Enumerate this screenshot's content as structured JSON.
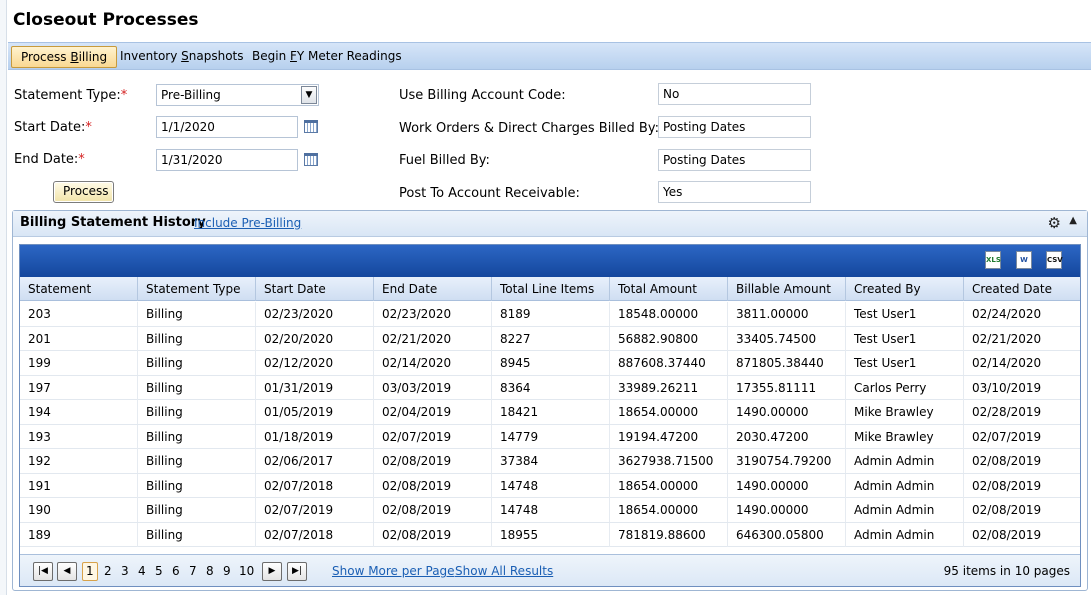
{
  "page": {
    "title": "Closeout Processes"
  },
  "tabs": [
    {
      "label_pre": "Process ",
      "mnemonic": "B",
      "label_post": "illing"
    },
    {
      "label_pre": "Inventory ",
      "mnemonic": "S",
      "label_post": "napshots"
    },
    {
      "label_pre": "Begin ",
      "mnemonic": "F",
      "label_post": "Y Meter Readings"
    }
  ],
  "form": {
    "statement_type_label": "Statement Type:",
    "statement_type_value": "Pre-Billing",
    "start_date_label": "Start Date:",
    "start_date_value": "1/1/2020",
    "end_date_label": "End Date:",
    "end_date_value": "1/31/2020",
    "required_marker": "*",
    "process_label": "Process",
    "use_billing_label": "Use Billing Account Code:",
    "use_billing_value": "No",
    "work_orders_label": "Work Orders & Direct Charges Billed By:",
    "work_orders_value": "Posting Dates",
    "fuel_label": "Fuel Billed By:",
    "fuel_value": "Posting Dates",
    "post_ar_label": "Post To Account Receivable:",
    "post_ar_value": "Yes"
  },
  "history": {
    "title": "Billing Statement History",
    "include_link": "Include Pre-Billing",
    "export_icons": [
      "excel-export-icon",
      "word-export-icon",
      "csv-export-icon"
    ],
    "columns": [
      "Statement",
      "Statement Type",
      "Start Date",
      "End Date",
      "Total Line Items",
      "Total Amount",
      "Billable Amount",
      "Created By",
      "Created Date"
    ],
    "rows": [
      [
        "203",
        "Billing",
        "02/23/2020",
        "02/23/2020",
        "8189",
        "18548.00000",
        "3811.00000",
        "Test User1",
        "02/24/2020"
      ],
      [
        "201",
        "Billing",
        "02/20/2020",
        "02/21/2020",
        "8227",
        "56882.90800",
        "33405.74500",
        "Test User1",
        "02/21/2020"
      ],
      [
        "199",
        "Billing",
        "02/12/2020",
        "02/14/2020",
        "8945",
        "887608.37440",
        "871805.38440",
        "Test User1",
        "02/14/2020"
      ],
      [
        "197",
        "Billing",
        "01/31/2019",
        "03/03/2019",
        "8364",
        "33989.26211",
        "17355.81111",
        "Carlos Perry",
        "03/10/2019"
      ],
      [
        "194",
        "Billing",
        "01/05/2019",
        "02/04/2019",
        "18421",
        "18654.00000",
        "1490.00000",
        "Mike Brawley",
        "02/28/2019"
      ],
      [
        "193",
        "Billing",
        "01/18/2019",
        "02/07/2019",
        "14779",
        "19194.47200",
        "2030.47200",
        "Mike Brawley",
        "02/07/2019"
      ],
      [
        "192",
        "Billing",
        "02/06/2017",
        "02/08/2019",
        "37384",
        "3627938.71500",
        "3190754.79200",
        "Admin Admin",
        "02/08/2019"
      ],
      [
        "191",
        "Billing",
        "02/07/2018",
        "02/08/2019",
        "14748",
        "18654.00000",
        "1490.00000",
        "Admin Admin",
        "02/08/2019"
      ],
      [
        "190",
        "Billing",
        "02/07/2019",
        "02/08/2019",
        "14748",
        "18654.00000",
        "1490.00000",
        "Admin Admin",
        "02/08/2019"
      ],
      [
        "189",
        "Billing",
        "02/07/2018",
        "02/08/2019",
        "18955",
        "781819.88600",
        "646300.05800",
        "Admin Admin",
        "02/08/2019"
      ]
    ]
  },
  "pager": {
    "pages": [
      "1",
      "2",
      "3",
      "4",
      "5",
      "6",
      "7",
      "8",
      "9",
      "10"
    ],
    "current_page": "1",
    "show_more": "Show More per Page",
    "show_all": "Show All Results",
    "info": "95 items in 10 pages"
  },
  "colors": {
    "accent": "#1b5fb4",
    "toolbar_blue": "#1e55b0",
    "required": "#d42020"
  }
}
